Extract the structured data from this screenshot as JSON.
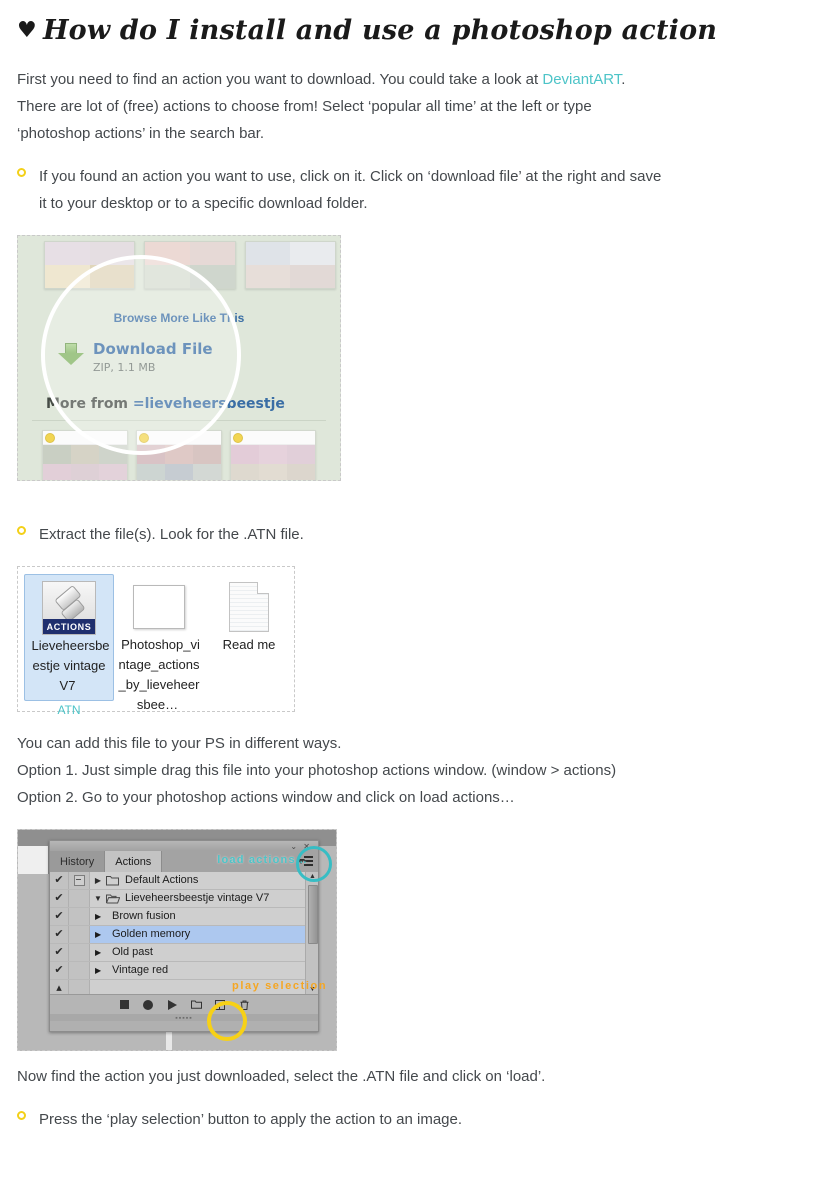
{
  "post": {
    "title": "How do I install and use a photoshop action",
    "title_heart": "♥"
  },
  "intro": {
    "line1_before": "First you need to find an action you want to download. You could take a look at ",
    "link_text": "DeviantART",
    "line1_after": ". There are lot of (free) actions to choose from! Select ‘popular all time’ at the left or type ‘photoshop actions’ in the search bar."
  },
  "bullets": {
    "b1": "If you found an action you want to use, click on it. Click on ‘download file’ at the right and save it to your desktop or to a specific download folder.",
    "b2": "Extract the file(s). Look for the .ATN file.",
    "b3": "Press the ‘play selection’ button to apply the action to an image."
  },
  "figure_deviantart": {
    "browse_more": "Browse More Like This",
    "download_title": "Download File",
    "download_meta": "ZIP, 1.1 MB",
    "more_from_label": "More from ",
    "more_from_user": "=lieveheersbeestje"
  },
  "options": {
    "intro": "You can add this file to your PS in different ways.",
    "option1": "Option 1. Just simple drag this file into your photoshop actions window. (window > actions)",
    "option2": "Option 2. Go to your photoshop actions window and click on load actions…"
  },
  "figure_files": {
    "items": [
      {
        "name": "Lieveheersbeestje vintage V7",
        "type_label": "ATN",
        "icon": "actions-file-icon",
        "selected": true
      },
      {
        "name": "Photoshop_vintage_actions_by_lieveheersbee…",
        "type_label": "",
        "icon": "image-file-icon",
        "selected": false
      },
      {
        "name": "Read me",
        "type_label": "",
        "icon": "text-document-icon",
        "selected": false
      }
    ],
    "actions_badge": "ACTIONS"
  },
  "figure_photoshop": {
    "tabs": [
      {
        "label": "History",
        "active": false
      },
      {
        "label": "Actions",
        "active": true
      }
    ],
    "rows": [
      {
        "check": "✔",
        "box": "minus",
        "twisty": "▶",
        "folder": "closed",
        "name": "Default Actions",
        "indent": false,
        "selected": false
      },
      {
        "check": "✔",
        "box": "empty",
        "twisty": "▼",
        "folder": "open",
        "name": "Lieveheersbeestje vintage V7",
        "indent": false,
        "selected": false
      },
      {
        "check": "✔",
        "box": "empty",
        "twisty": "▶",
        "folder": "none",
        "name": "Brown fusion",
        "indent": true,
        "selected": false
      },
      {
        "check": "✔",
        "box": "empty",
        "twisty": "▶",
        "folder": "none",
        "name": "Golden memory",
        "indent": true,
        "selected": true
      },
      {
        "check": "✔",
        "box": "empty",
        "twisty": "▶",
        "folder": "none",
        "name": "Old past",
        "indent": true,
        "selected": false
      },
      {
        "check": "✔",
        "box": "empty",
        "twisty": "▶",
        "folder": "none",
        "name": "Vintage red",
        "indent": true,
        "selected": false
      }
    ],
    "annotation_load": "load actions…",
    "annotation_play": "play selection",
    "toolbar_icons": [
      "stop-icon",
      "record-icon",
      "play-icon",
      "new-set-icon",
      "new-action-icon",
      "delete-icon"
    ]
  },
  "closing": {
    "line": "Now find the action you just downloaded, select the .ATN file and click on ‘load’."
  },
  "colors": {
    "link": "#4dc4c8",
    "bullet": "#f3d019",
    "annotation_teal": "#4dc4c8",
    "annotation_orange": "#f5a623",
    "highlight_circle_yellow": "#f7d117",
    "selection_blue": "#adc8ef"
  }
}
